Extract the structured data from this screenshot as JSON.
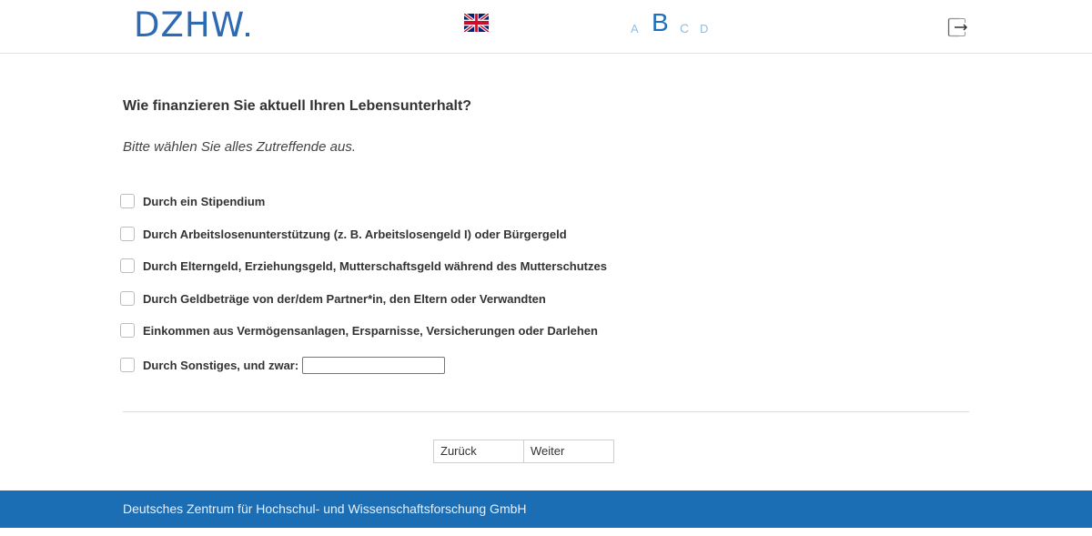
{
  "header": {
    "logo_text": "DZHW",
    "language_flag": "uk-flag-icon",
    "font_sizes": [
      "A",
      "B",
      "C",
      "D"
    ],
    "logout_icon": "logout-icon"
  },
  "question": {
    "title": "Wie finanzieren Sie aktuell Ihren Lebensunterhalt?",
    "instruction": "Bitte wählen Sie alles Zutreffende aus."
  },
  "options": [
    {
      "label": "Durch ein Stipendium",
      "checked": false
    },
    {
      "label": "Durch Arbeitslosenunterstützung (z. B. Arbeitslosengeld I) oder Bürgergeld",
      "checked": false
    },
    {
      "label": "Durch Elterngeld, Erziehungsgeld, Mutterschaftsgeld während des Mutterschutzes",
      "checked": false
    },
    {
      "label": "Durch Geldbeträge von der/dem Partner*in, den Eltern oder Verwandten",
      "checked": false
    },
    {
      "label": "Einkommen aus Vermögensanlagen, Ersparnisse, Versicherungen oder Darlehen",
      "checked": false
    },
    {
      "label": "Durch Sonstiges, und zwar:",
      "checked": false,
      "text_value": ""
    }
  ],
  "navigation": {
    "back_label": "Zurück",
    "next_label": "Weiter"
  },
  "footer": {
    "text": "Deutsches Zentrum für Hochschul- und Wissenschaftsforschung GmbH"
  },
  "colors": {
    "brand_blue": "#2d6ab4",
    "footer_blue": "#1b6db4",
    "font_size_inactive": "#8fbde3",
    "font_size_active": "#1f6fbf"
  }
}
